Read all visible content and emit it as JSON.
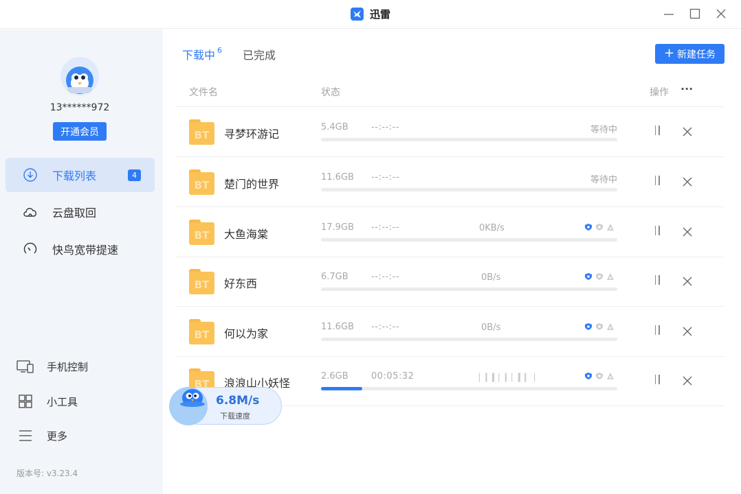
{
  "app": {
    "title": "迅雷"
  },
  "user": {
    "account": "13******972",
    "vip_button": "开通会员"
  },
  "sidebar": {
    "items": [
      {
        "label": "下载列表",
        "badge": "4",
        "icon": "download-icon"
      },
      {
        "label": "云盘取回",
        "icon": "cloud-icon"
      },
      {
        "label": "快鸟宽带提速",
        "icon": "speedometer-icon"
      }
    ],
    "bottom": [
      {
        "label": "手机控制",
        "icon": "devices-icon"
      },
      {
        "label": "小工具",
        "icon": "grid-icon"
      },
      {
        "label": "更多",
        "icon": "menu-icon"
      }
    ],
    "version": "版本号: v3.23.4"
  },
  "tabs": {
    "downloading": "下载中",
    "downloading_count": "6",
    "completed": "已完成"
  },
  "toolbar": {
    "new_task": "新建任务"
  },
  "table": {
    "headers": {
      "name": "文件名",
      "status": "状态",
      "actions": "操作",
      "more": "···"
    },
    "rows": [
      {
        "name": "寻梦环游记",
        "size": "5.4GB",
        "eta": "--:--:--",
        "speed": "",
        "state": "等待中",
        "progress": 0
      },
      {
        "name": "楚门的世界",
        "size": "11.6GB",
        "eta": "--:--:--",
        "speed": "",
        "state": "等待中",
        "progress": 0
      },
      {
        "name": "大鱼海棠",
        "size": "17.9GB",
        "eta": "--:--:--",
        "speed": "0KB/s",
        "state": "",
        "progress": 0
      },
      {
        "name": "好东西",
        "size": "6.7GB",
        "eta": "--:--:--",
        "speed": "0B/s",
        "state": "",
        "progress": 0
      },
      {
        "name": "何以为家",
        "size": "11.6GB",
        "eta": "--:--:--",
        "speed": "0B/s",
        "state": "",
        "progress": 0
      },
      {
        "name": "浪浪山小妖怪",
        "size": "2.6GB",
        "eta": "00:05:32",
        "speed": "",
        "state": "",
        "progress": 0.14
      }
    ],
    "file_icon_text": "BT"
  },
  "speed_widget": {
    "value": "6.8M/s",
    "label": "下载速度"
  },
  "colors": {
    "accent": "#2f7bf5",
    "sidebar_bg": "#f2f5fa",
    "folder": "#fbc255"
  }
}
